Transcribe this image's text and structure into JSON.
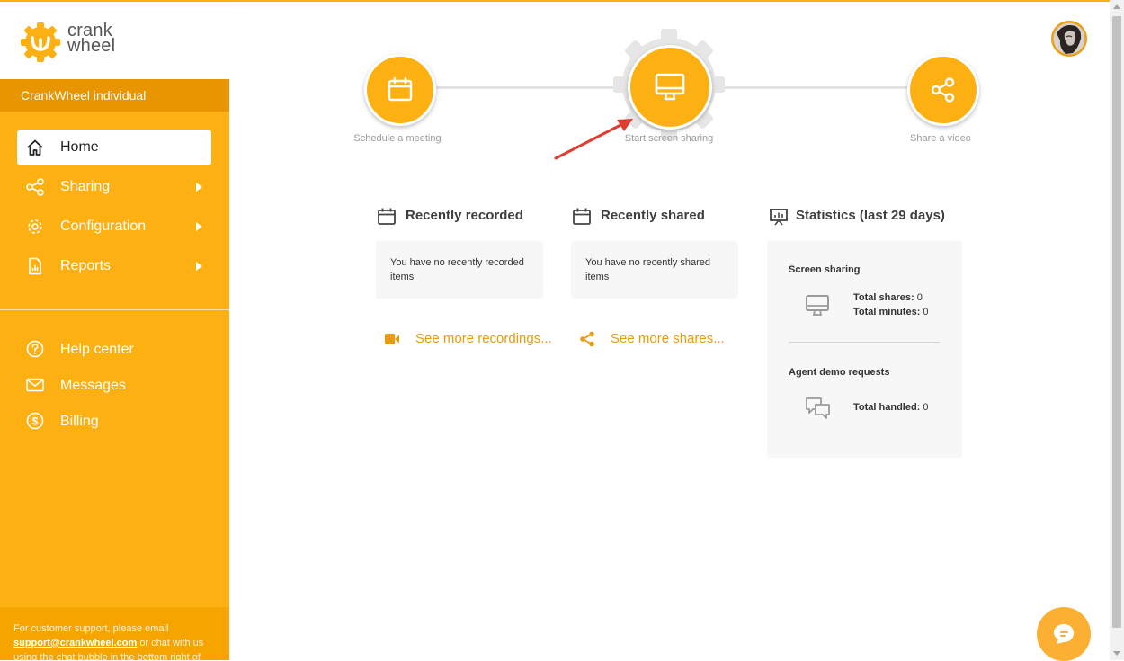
{
  "brand": {
    "line1": "crank",
    "line2": "wheel"
  },
  "account": {
    "name": "CrankWheel individual"
  },
  "nav": {
    "home": "Home",
    "sharing": "Sharing",
    "configuration": "Configuration",
    "reports": "Reports",
    "help": "Help center",
    "messages": "Messages",
    "billing": "Billing"
  },
  "support": {
    "prefix": "For customer support, please email ",
    "email": "support@crankwheel.com",
    "suffix": " or chat with us using the chat bubble in the bottom right of"
  },
  "steps": {
    "schedule": "Schedule a meeting",
    "screen": "Start screen sharing",
    "video": "Share a video"
  },
  "recorded": {
    "title": "Recently recorded",
    "empty": "You have no recently recorded items",
    "more": "See more recordings..."
  },
  "shared": {
    "title": "Recently shared",
    "empty": "You have no recently shared items",
    "more": "See more shares..."
  },
  "stats": {
    "title": "Statistics (last 29 days)",
    "screen_title": "Screen sharing",
    "shares_label": "Total shares:",
    "shares_value": "0",
    "minutes_label": "Total minutes:",
    "minutes_value": "0",
    "agent_title": "Agent demo requests",
    "handled_label": "Total handled:",
    "handled_value": "0"
  },
  "colors": {
    "accent": "#fdb012",
    "accent_dark": "#e99500",
    "link": "#e79c0f"
  }
}
